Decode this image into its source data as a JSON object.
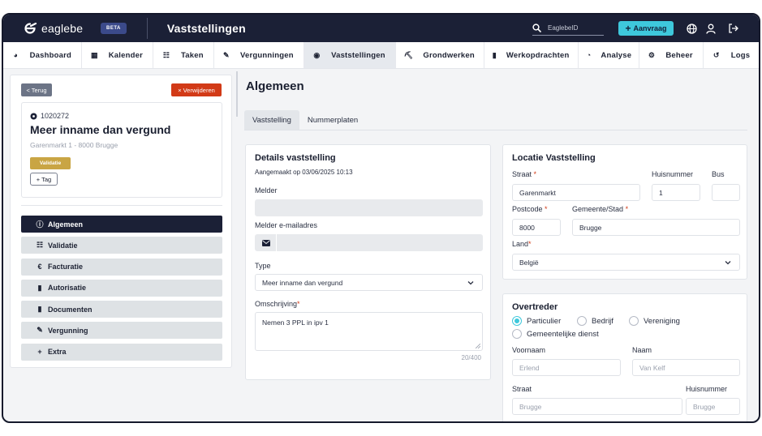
{
  "topbar": {
    "logo_text": "eaglebe",
    "beta_label": "BETA",
    "page_title": "Vaststellingen",
    "search_placeholder": "EaglebeID",
    "aanvraag_label": "Aanvraag"
  },
  "nav": {
    "items": [
      {
        "label": "Dashboard"
      },
      {
        "label": "Kalender"
      },
      {
        "label": "Taken"
      },
      {
        "label": "Vergunningen"
      },
      {
        "label": "Vaststellingen"
      },
      {
        "label": "Grondwerken"
      },
      {
        "label": "Werkopdrachten"
      },
      {
        "label": "Analyse"
      },
      {
        "label": "Beheer"
      },
      {
        "label": "Logs"
      }
    ]
  },
  "left": {
    "back_label": "< Terug",
    "delete_label": "Verwijderen",
    "case_id": "1020272",
    "case_title": "Meer inname dan vergund",
    "case_address": "Garenmarkt 1 - 8000 Brugge",
    "status_badge": "Validatie",
    "tag_label": "+ Tag",
    "menu": [
      {
        "label": "Algemeen"
      },
      {
        "label": "Validatie"
      },
      {
        "label": "Facturatie"
      },
      {
        "label": "Autorisatie"
      },
      {
        "label": "Documenten"
      },
      {
        "label": "Vergunning"
      },
      {
        "label": "Extra"
      }
    ]
  },
  "main": {
    "title": "Algemeen",
    "tabs": [
      {
        "label": "Vaststelling"
      },
      {
        "label": "Nummerplaten"
      }
    ]
  },
  "details": {
    "title": "Details vaststelling",
    "created": "Aangemaakt op 03/06/2025 10:13",
    "melder_label": "Melder",
    "melder_value": "",
    "email_label": "Melder e-mailadres",
    "email_value": "",
    "type_label": "Type",
    "type_value": "Meer inname dan vergund",
    "omschrijving_label": "Omschrijving",
    "omschrijving_value": "Nemen 3 PPL in ipv 1",
    "char_count": "20/400"
  },
  "locatie": {
    "title": "Locatie Vaststelling",
    "straat_label": "Straat",
    "straat_value": "Garenmarkt",
    "huisnummer_label": "Huisnummer",
    "huisnummer_value": "1",
    "bus_label": "Bus",
    "bus_value": "",
    "postcode_label": "Postcode",
    "postcode_value": "8000",
    "gemeente_label": "Gemeente/Stad",
    "gemeente_value": "Brugge",
    "land_label": "Land",
    "land_value": "België"
  },
  "overtreder": {
    "title": "Overtreder",
    "options": [
      {
        "label": "Particulier",
        "selected": true
      },
      {
        "label": "Bedrijf",
        "selected": false
      },
      {
        "label": "Vereniging",
        "selected": false
      },
      {
        "label": "Gemeentelijke dienst",
        "selected": false
      }
    ],
    "voornaam_label": "Voornaam",
    "voornaam_placeholder": "Erlend",
    "naam_label": "Naam",
    "naam_placeholder": "Van Kelf",
    "straat_label": "Straat",
    "straat_placeholder": "Brugge",
    "huisnummer_label": "Huisnummer",
    "huisnummer_placeholder": "Brugge"
  },
  "colors": {
    "navy": "#1b2036",
    "accent": "#3ec8dc",
    "danger": "#d23a17",
    "badge": "#c9a544"
  }
}
